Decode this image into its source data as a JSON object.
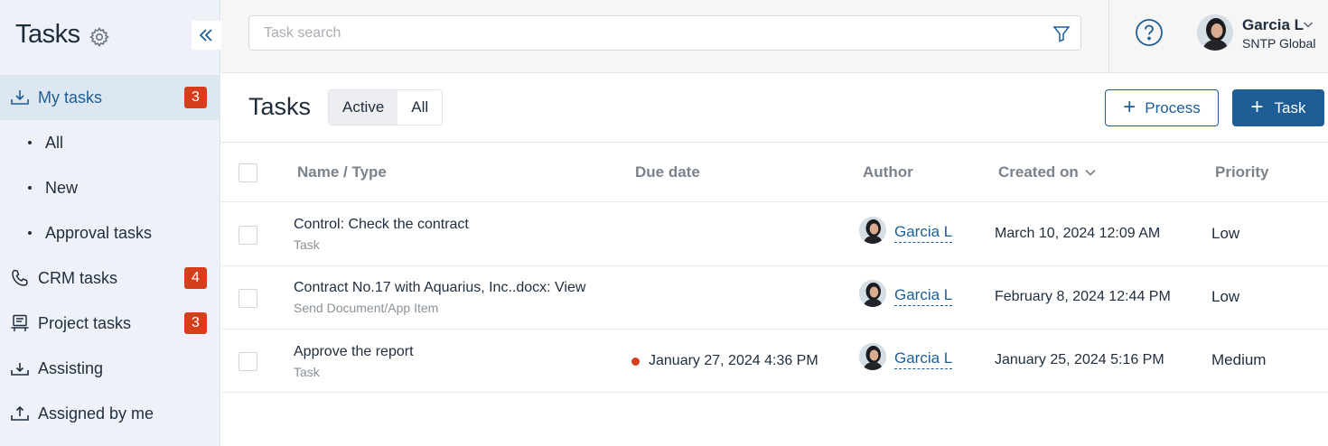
{
  "sidebar": {
    "title": "Tasks",
    "items": [
      {
        "label": "My tasks",
        "badge": "3",
        "icon": "inbox-download-icon"
      },
      {
        "label": "All"
      },
      {
        "label": "New"
      },
      {
        "label": "Approval tasks"
      },
      {
        "label": "CRM tasks",
        "badge": "4",
        "icon": "phone-icon"
      },
      {
        "label": "Project tasks",
        "badge": "3",
        "icon": "project-board-icon"
      },
      {
        "label": "Assisting",
        "icon": "tray-in-icon"
      },
      {
        "label": "Assigned by me",
        "icon": "tray-out-icon"
      }
    ]
  },
  "search": {
    "placeholder": "Task search"
  },
  "user": {
    "name": "Garcia L",
    "org": "SNTP Global"
  },
  "main": {
    "title": "Tasks",
    "tabs": [
      {
        "label": "Active",
        "selected": true
      },
      {
        "label": "All",
        "selected": false
      }
    ],
    "process_button": "Process",
    "task_button": "Task"
  },
  "table": {
    "columns": [
      "Name / Type",
      "Due date",
      "Author",
      "Created on",
      "Priority"
    ],
    "rows": [
      {
        "name": "Control: Check the contract",
        "type": "Task",
        "due": "",
        "author": "Garcia L",
        "created": "March 10, 2024 12:09 AM",
        "priority": "Low"
      },
      {
        "name": "Contract No.17 with Aquarius, Inc..docx: View",
        "type": "Send Document/App Item",
        "due": "",
        "author": "Garcia L",
        "created": "February 8, 2024 12:44 PM",
        "priority": "Low"
      },
      {
        "name": "Approve the report",
        "type": "Task",
        "due": "January 27, 2024 4:36 PM",
        "author": "Garcia L",
        "created": "January 25, 2024 5:16 PM",
        "priority": "Medium"
      }
    ]
  },
  "colors": {
    "accent": "#1e5d95",
    "badge": "#d63d1a",
    "sidebar_bg": "#eef2f8",
    "overdue": "#d63d1a"
  }
}
